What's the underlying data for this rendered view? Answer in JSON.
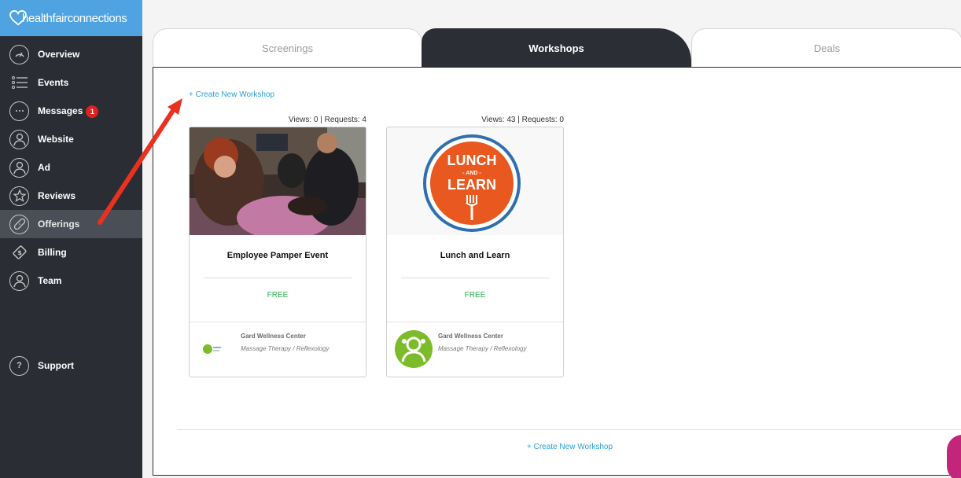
{
  "brand": {
    "name": "healthfairconnections"
  },
  "sidebar": {
    "items": [
      {
        "label": "Overview",
        "icon": "gauge-icon"
      },
      {
        "label": "Events",
        "icon": "list-icon"
      },
      {
        "label": "Messages",
        "icon": "chat-icon",
        "badge": "1"
      },
      {
        "label": "Website",
        "icon": "user-circle-icon"
      },
      {
        "label": "Ad",
        "icon": "user-circle-icon"
      },
      {
        "label": "Reviews",
        "icon": "star-icon"
      },
      {
        "label": "Offerings",
        "icon": "bandage-icon",
        "active": true
      },
      {
        "label": "Billing",
        "icon": "tag-icon"
      },
      {
        "label": "Team",
        "icon": "user-circle-icon"
      }
    ],
    "support": {
      "label": "Support",
      "icon": "question-icon"
    }
  },
  "tabs": [
    {
      "label": "Screenings"
    },
    {
      "label": "Workshops",
      "active": true
    },
    {
      "label": "Deals"
    }
  ],
  "main": {
    "create_link": "+ Create New Workshop",
    "cards": [
      {
        "stats": "Views: 0 | Requests: 4",
        "title": "Employee Pamper Event",
        "price": "FREE",
        "provider": "Gard Wellness Center",
        "category": "Massage Therapy / Reflexology"
      },
      {
        "stats": "Views: 43 | Requests: 0",
        "title": "Lunch and Learn",
        "price": "FREE",
        "provider": "Gard Wellness Center",
        "category": "Massage Therapy / Reflexology",
        "logo": {
          "line1": "LUNCH",
          "line2": "- AND -",
          "line3": "LEARN"
        }
      }
    ]
  },
  "colors": {
    "sidebar_bg": "#2a2d33",
    "brand_bg": "#4fa3e0",
    "link": "#2a9fd6",
    "price": "#27b24a",
    "badge": "#e02020",
    "arrow": "#e8321f",
    "lunch_orange": "#e8581f",
    "lunch_ring": "#2f6fb0"
  }
}
